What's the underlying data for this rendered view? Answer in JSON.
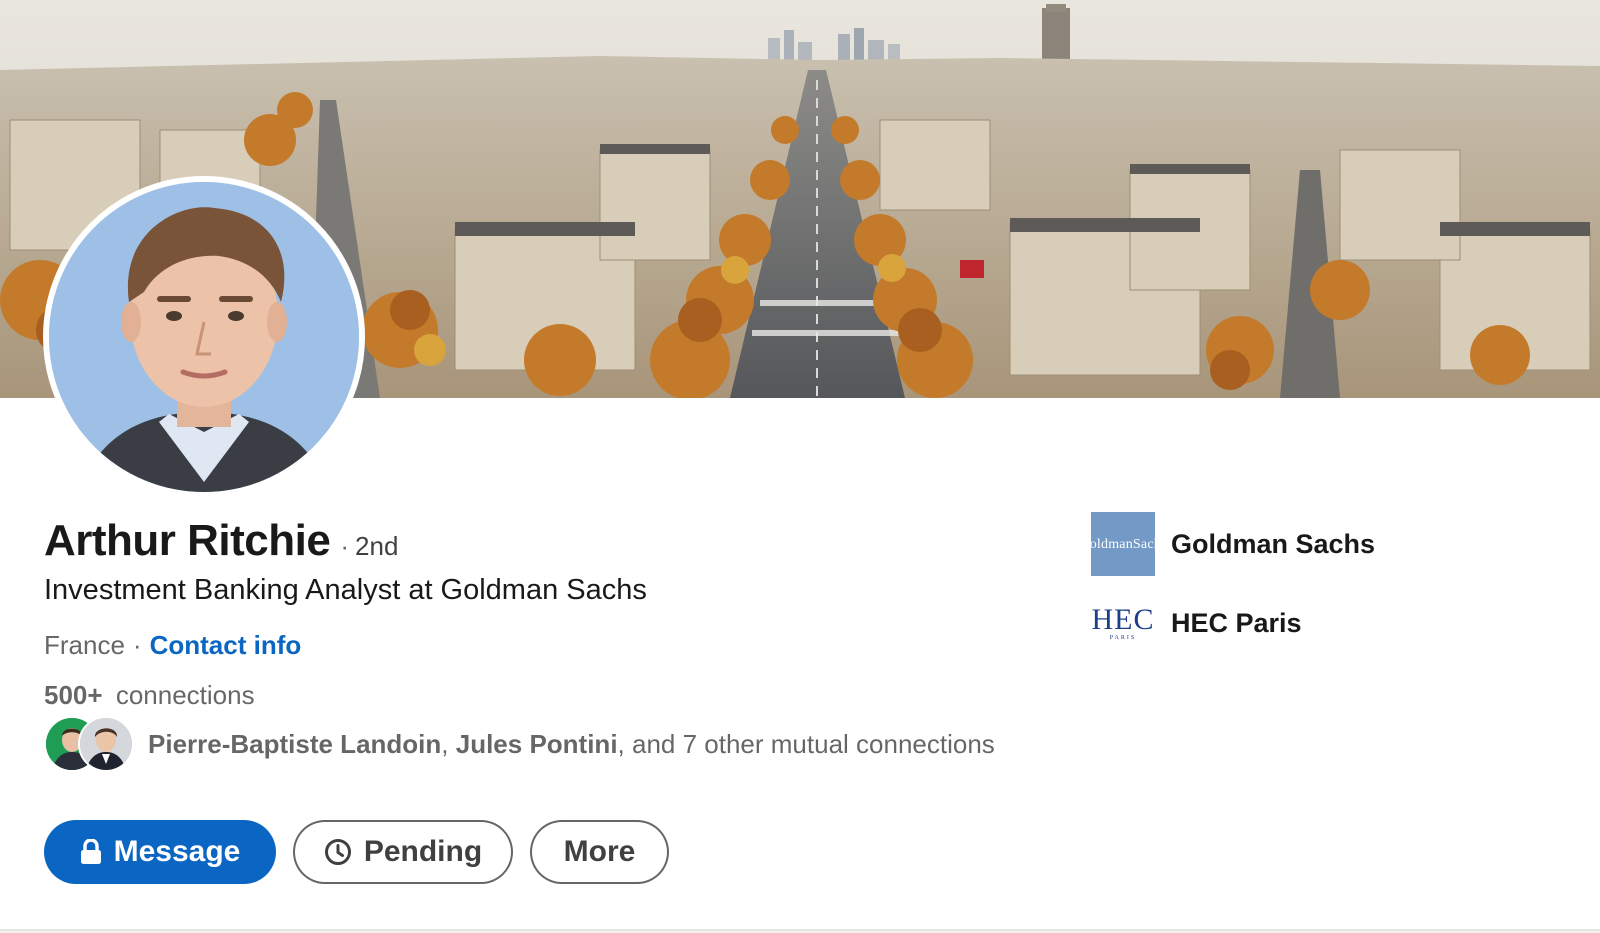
{
  "profile": {
    "name": "Arthur Ritchie",
    "degree": "2nd",
    "headline": "Investment Banking Analyst at Goldman Sachs",
    "location": "France",
    "contact_info_label": "Contact info",
    "connections_count": "500+",
    "connections_label": "connections"
  },
  "mutual": {
    "names": [
      "Pierre-Baptiste Landoin",
      "Jules Pontini"
    ],
    "rest": ", and 7 other mutual connections",
    "separator": ", "
  },
  "actions": {
    "message": "Message",
    "pending": "Pending",
    "more": "More"
  },
  "organizations": [
    {
      "name": "Goldman Sachs",
      "logo_text": [
        "Goldman",
        "Sachs"
      ]
    },
    {
      "name": "HEC Paris",
      "logo_text": [
        "HEC",
        "PARIS"
      ]
    }
  ],
  "icons": {
    "message": "lock-icon",
    "pending": "clock-icon"
  },
  "colors": {
    "primary": "#0a66c2",
    "goldman_logo_bg": "#7399c6",
    "hec_logo": "#1d3f8a"
  }
}
